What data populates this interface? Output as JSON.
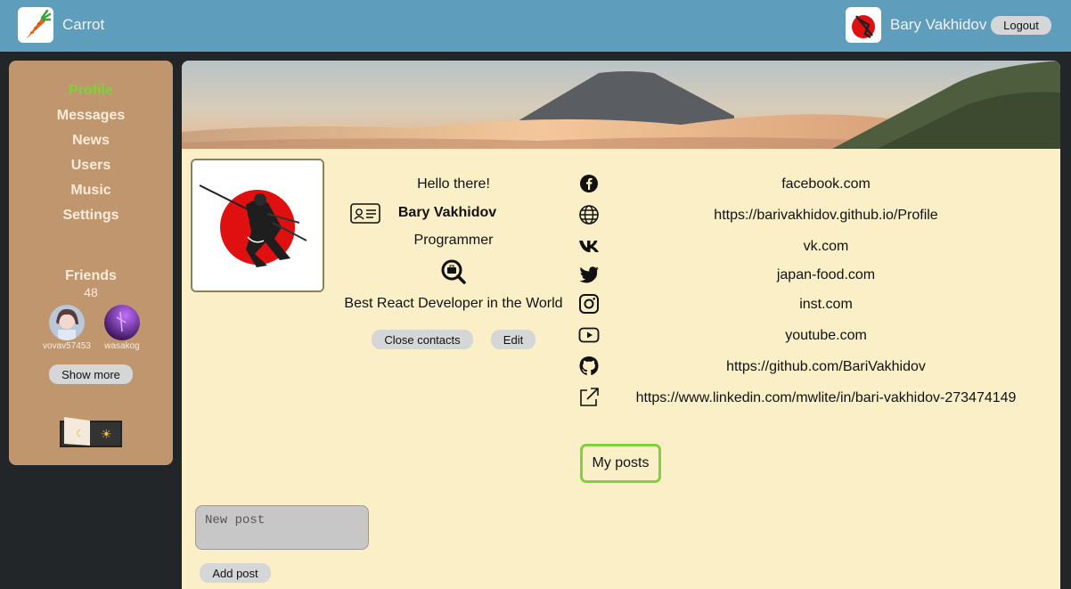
{
  "header": {
    "app_title": "Carrot",
    "user_name": "Bary Vakhidov",
    "logout_label": "Logout",
    "logo_icon": "carrot-icon",
    "header_color": "#5e9dbb"
  },
  "sidebar": {
    "items": [
      {
        "label": "Profile",
        "active": true
      },
      {
        "label": "Messages",
        "active": false
      },
      {
        "label": "News",
        "active": false
      },
      {
        "label": "Users",
        "active": false
      },
      {
        "label": "Music",
        "active": false
      },
      {
        "label": "Settings",
        "active": false
      }
    ],
    "friends_title": "Friends",
    "friends_count": "48",
    "friends": [
      {
        "name": "vovav57453"
      },
      {
        "name": "wasakog"
      }
    ],
    "show_more_label": "Show more",
    "active_color": "#7fd13d"
  },
  "profile": {
    "greeting": "Hello there!",
    "full_name": "Bary Vakhidov",
    "job_status": "Programmer",
    "about": "Best React Developer in the World",
    "close_contacts_label": "Close contacts",
    "edit_label": "Edit"
  },
  "contacts": [
    {
      "icon": "facebook-icon",
      "value": "facebook.com"
    },
    {
      "icon": "globe-icon",
      "value": "https://barivakhidov.github.io/Profile"
    },
    {
      "icon": "vk-icon",
      "value": "vk.com"
    },
    {
      "icon": "twitter-icon",
      "value": "japan-food.com"
    },
    {
      "icon": "instagram-icon",
      "value": "inst.com"
    },
    {
      "icon": "youtube-icon",
      "value": "youtube.com"
    },
    {
      "icon": "github-icon",
      "value": "https://github.com/BariVakhidov"
    },
    {
      "icon": "external-link-icon",
      "value": "https://www.linkedin.com/mwlite/in/bari-vakhidov-273474149"
    }
  ],
  "posts": {
    "title": "My posts",
    "new_post_placeholder": "New post",
    "add_post_label": "Add post"
  }
}
